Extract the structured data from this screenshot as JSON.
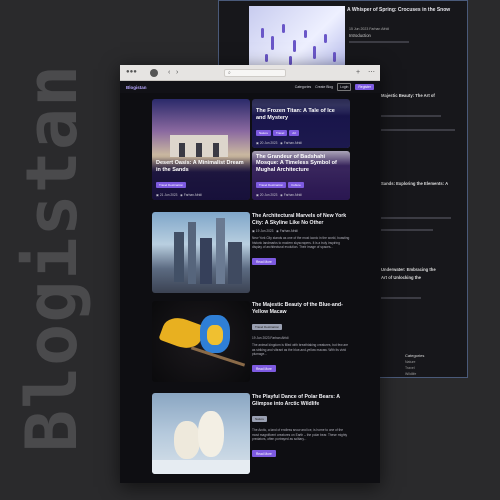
{
  "side_text": "Blogistan",
  "back_window": {
    "top_title": "A Whisper of Spring: Crocuses in the Snow",
    "top_meta": "15 Jun 2023   Farhan Afridi",
    "top_intro": "Introduction",
    "frag1": "Majestic Beauty: The Art of",
    "frag2": "Sands: Exploring the Elements: A",
    "frag3": "Underwater: Embracing the",
    "frag4": "Art of Unlocking the",
    "categories_title": "Categories",
    "categories": [
      "Nature",
      "Travel",
      "Wildlife"
    ]
  },
  "front_window": {
    "toolbar": {
      "sidebar_icon": "sidebar-icon",
      "back": "‹",
      "forward": "›",
      "new_tab": "+",
      "menu": "⋯"
    },
    "nav": {
      "logo": "Blogistan",
      "links": [
        "Categories",
        "Create Blog",
        "Login",
        "Register"
      ]
    },
    "featured": {
      "main": {
        "title": "Desert Oasis: A Minimalist Dream in the Sands",
        "tags": [
          "Travel Destination"
        ],
        "date": "21 Jun 2023",
        "author": "Farhan Afridi"
      },
      "side1": {
        "title": "The Frozen Titan: A Tale of Ice and Mystery",
        "tags": [
          "Nature",
          "Travel",
          "Art"
        ],
        "date": "20 Jun 2023",
        "author": "Farhan Afridi"
      },
      "side2": {
        "title": "The Grandeur of Badshahi Mosque: A Timeless Symbol of Mughal Architecture",
        "tags": [
          "Travel Destination",
          "Culture"
        ],
        "date": "20 Jun 2023",
        "author": "Farhan Afridi"
      }
    },
    "posts": [
      {
        "title": "The Architectural Marvels of New York City: A Skyline Like No Other",
        "date": "19 Jun 2023",
        "author": "Farhan Afridi",
        "tag": "",
        "desc": "New York City stands as one of the most iconic in the world, boasting historic landmarks to modern skyscrapers. It is a truly inspiring display of architectural evolution. Their image of spaces...",
        "button": "Read More"
      },
      {
        "title": "The Majestic Beauty of the Blue-and-Yellow Macaw",
        "date": "",
        "author": "",
        "tag": "Travel Destination",
        "desc": "The animal kingdom is filled with breathtaking creatures, but few are as striking and vibrant as the blue-and-yellow macaw. With its vivid plumage...",
        "button": "Read More",
        "extra_meta": "19 Jun 2023   Farhan Afridi"
      },
      {
        "title": "The Playful Dance of Polar Bears: A Glimpse into Arctic Wildlife",
        "date": "18 Jun 2023",
        "author": "Farhan Afridi",
        "tag": "Nature",
        "desc": "The Arctic, a land of endless snow and ice, is home to one of the most magnificent creatures on Earth – the polar bear. These mighty predators, often portrayed as solitary...",
        "button": "Read More"
      }
    ]
  }
}
